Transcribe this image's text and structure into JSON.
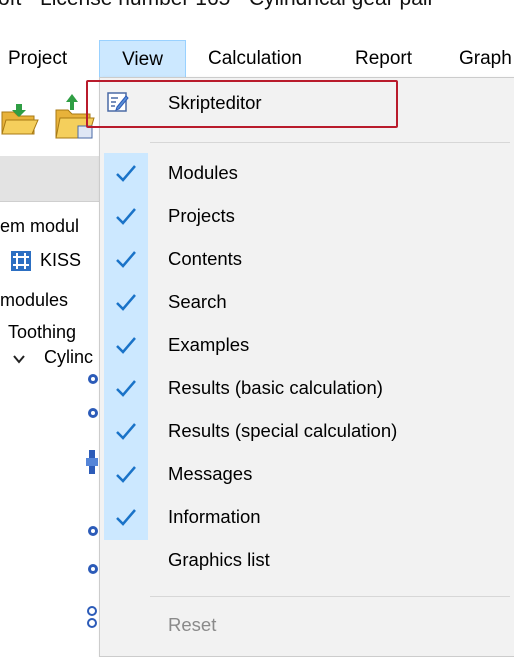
{
  "window": {
    "title_fragment": "oft - License number 165 - Cylindrical gear pair"
  },
  "menubar": {
    "items": [
      {
        "label": "Project"
      },
      {
        "label": "View"
      },
      {
        "label": "Calculation"
      },
      {
        "label": "Report"
      },
      {
        "label": "Graph"
      }
    ]
  },
  "left_panel": {
    "system_modules_fragment": "em modul",
    "kiss_fragment": "KISS",
    "modules_fragment": "modules",
    "toothing_label": "Toothing",
    "cylinder_fragment": "Cylinc"
  },
  "view_menu": {
    "skripteditor_label": "Skripteditor",
    "items": [
      {
        "label": "Modules",
        "checked": true
      },
      {
        "label": "Projects",
        "checked": true
      },
      {
        "label": "Contents",
        "checked": true
      },
      {
        "label": "Search",
        "checked": true
      },
      {
        "label": "Examples",
        "checked": true
      },
      {
        "label": "Results (basic calculation)",
        "checked": true
      },
      {
        "label": "Results (special calculation)",
        "checked": true
      },
      {
        "label": "Messages",
        "checked": true
      },
      {
        "label": "Information",
        "checked": true
      },
      {
        "label": "Graphics list",
        "checked": false
      }
    ],
    "reset_label": "Reset"
  },
  "colors": {
    "menu_highlight": "#cce8ff",
    "annotation_red": "#b91b2c",
    "check_blue": "#1a73c8"
  }
}
